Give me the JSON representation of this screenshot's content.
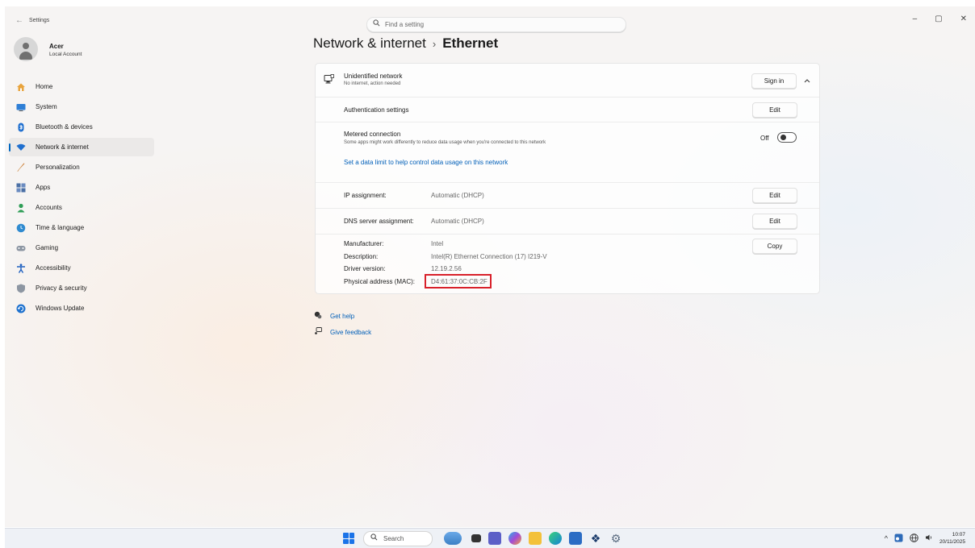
{
  "app": {
    "title": "Settings",
    "back_glyph": "←"
  },
  "search": {
    "placeholder": "Find a setting"
  },
  "window_controls": {
    "minimize": "–",
    "maximize": "▢",
    "close": "✕"
  },
  "account": {
    "name": "Acer",
    "type": "Local Account"
  },
  "sidebar": {
    "items": [
      {
        "label": "Home",
        "icon": "home-icon"
      },
      {
        "label": "System",
        "icon": "system-icon"
      },
      {
        "label": "Bluetooth & devices",
        "icon": "bluetooth-icon"
      },
      {
        "label": "Network & internet",
        "icon": "wifi-icon",
        "active": true
      },
      {
        "label": "Personalization",
        "icon": "brush-icon"
      },
      {
        "label": "Apps",
        "icon": "apps-icon"
      },
      {
        "label": "Accounts",
        "icon": "accounts-icon"
      },
      {
        "label": "Time & language",
        "icon": "globe-clock-icon"
      },
      {
        "label": "Gaming",
        "icon": "gamepad-icon"
      },
      {
        "label": "Accessibility",
        "icon": "accessibility-icon"
      },
      {
        "label": "Privacy & security",
        "icon": "shield-icon"
      },
      {
        "label": "Windows Update",
        "icon": "update-icon"
      }
    ]
  },
  "breadcrumb": {
    "parent": "Network & internet",
    "separator": "›",
    "current": "Ethernet"
  },
  "network": {
    "name": "Unidentified network",
    "status": "No internet, action needed",
    "sign_in_label": "Sign in",
    "chevron": "^"
  },
  "auth": {
    "label": "Authentication settings",
    "button": "Edit"
  },
  "metered": {
    "label": "Metered connection",
    "description": "Some apps might work differently to reduce data usage when you're connected to this network",
    "toggle_state": "Off",
    "link": "Set a data limit to help control data usage on this network"
  },
  "ip": {
    "label": "IP assignment:",
    "value": "Automatic (DHCP)",
    "button": "Edit"
  },
  "dns": {
    "label": "DNS server assignment:",
    "value": "Automatic (DHCP)",
    "button": "Edit"
  },
  "properties": {
    "copy_label": "Copy",
    "rows": [
      {
        "label": "Manufacturer:",
        "value": "Intel"
      },
      {
        "label": "Description:",
        "value": "Intel(R) Ethernet Connection (17) I219-V"
      },
      {
        "label": "Driver version:",
        "value": "12.19.2.56"
      },
      {
        "label": "Physical address (MAC):",
        "value": "D4:61:37:0C:CB:2F"
      }
    ]
  },
  "help": {
    "get_help": "Get help",
    "feedback": "Give feedback"
  },
  "taskbar": {
    "search_label": "Search",
    "time": "10:07",
    "date": "20/11/2025",
    "tray_chevron": "^"
  },
  "colors": {
    "accent": "#0067c0",
    "link": "#005fb8",
    "highlight": "#d8202a"
  }
}
